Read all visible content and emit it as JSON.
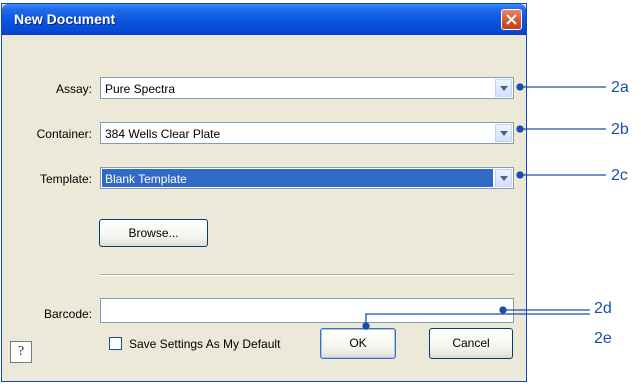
{
  "dialog": {
    "title": "New Document",
    "assay": {
      "label": "Assay:",
      "value": "Pure Spectra"
    },
    "container": {
      "label": "Container:",
      "value": "384 Wells Clear Plate"
    },
    "template": {
      "label": "Template:",
      "value": "Blank Template"
    },
    "browse_label": "Browse...",
    "barcode": {
      "label": "Barcode:",
      "value": ""
    },
    "save_default_label": "Save Settings As My Default",
    "save_default_checked": false,
    "ok_label": "OK",
    "cancel_label": "Cancel",
    "help_label": "?"
  },
  "callouts": {
    "c2a": "2a",
    "c2b": "2b",
    "c2c": "2c",
    "c2d": "2d",
    "c2e": "2e"
  },
  "colors": {
    "titlebar": "#0a54e0",
    "selection": "#316ac5",
    "callout": "#1a4fa8",
    "dialog_bg": "#ece9d8"
  }
}
